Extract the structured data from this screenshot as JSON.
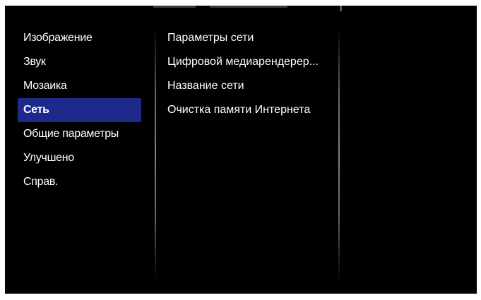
{
  "menu": {
    "items": [
      {
        "label": "Изображение",
        "selected": false
      },
      {
        "label": "Звук",
        "selected": false
      },
      {
        "label": "Мозаика",
        "selected": false
      },
      {
        "label": "Сеть",
        "selected": true
      },
      {
        "label": "Общие параметры",
        "selected": false
      },
      {
        "label": "Улучшено",
        "selected": false
      },
      {
        "label": "Справ.",
        "selected": false
      }
    ]
  },
  "submenu": {
    "items": [
      {
        "label": "Параметры сети"
      },
      {
        "label": "Цифровой медиарендерер..."
      },
      {
        "label": "Название сети"
      },
      {
        "label": "Очистка памяти Интернета"
      }
    ]
  },
  "colors": {
    "background": "#000000",
    "selection": "#1d2a8c",
    "text": "#ffffff"
  }
}
